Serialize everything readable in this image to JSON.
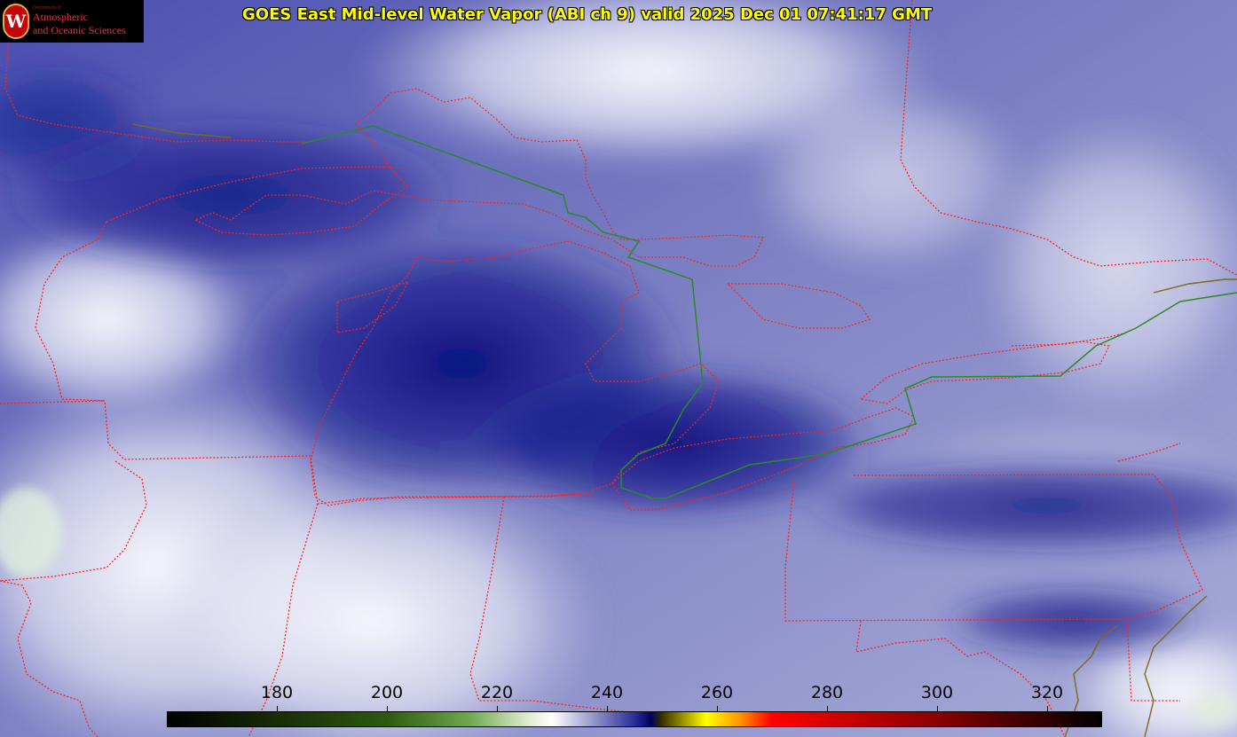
{
  "header": {
    "title": "GOES East Mid-level Water Vapor (ABI ch 9)  valid 2025 Dec 01 07:41:17 GMT"
  },
  "logo": {
    "dept": "Department of",
    "line1": "Atmospheric",
    "line2": "and Oceanic Sciences",
    "seal_letter": "W"
  },
  "colorbar": {
    "ticks": [
      "180",
      "200",
      "220",
      "240",
      "260",
      "280",
      "300",
      "320"
    ],
    "tick_values": [
      180,
      200,
      220,
      240,
      260,
      280,
      300,
      320
    ],
    "range": [
      160,
      330
    ],
    "stops": [
      {
        "v": 160,
        "c": "#000000"
      },
      {
        "v": 200,
        "c": "#2e5a10"
      },
      {
        "v": 215,
        "c": "#6fa850"
      },
      {
        "v": 225,
        "c": "#d9e8c8"
      },
      {
        "v": 230,
        "c": "#ffffff"
      },
      {
        "v": 245,
        "c": "#2a2e9a"
      },
      {
        "v": 248,
        "c": "#000060"
      },
      {
        "v": 250,
        "c": "#3a3000"
      },
      {
        "v": 258,
        "c": "#ffff00"
      },
      {
        "v": 264,
        "c": "#ff9a00"
      },
      {
        "v": 270,
        "c": "#ff0000"
      },
      {
        "v": 300,
        "c": "#8a0000"
      },
      {
        "v": 330,
        "c": "#000000"
      }
    ]
  },
  "colors": {
    "border": "#ff2020",
    "intl_border": "#2a8a2a",
    "coast": "#7a6a1a",
    "title": "#ffff00"
  }
}
